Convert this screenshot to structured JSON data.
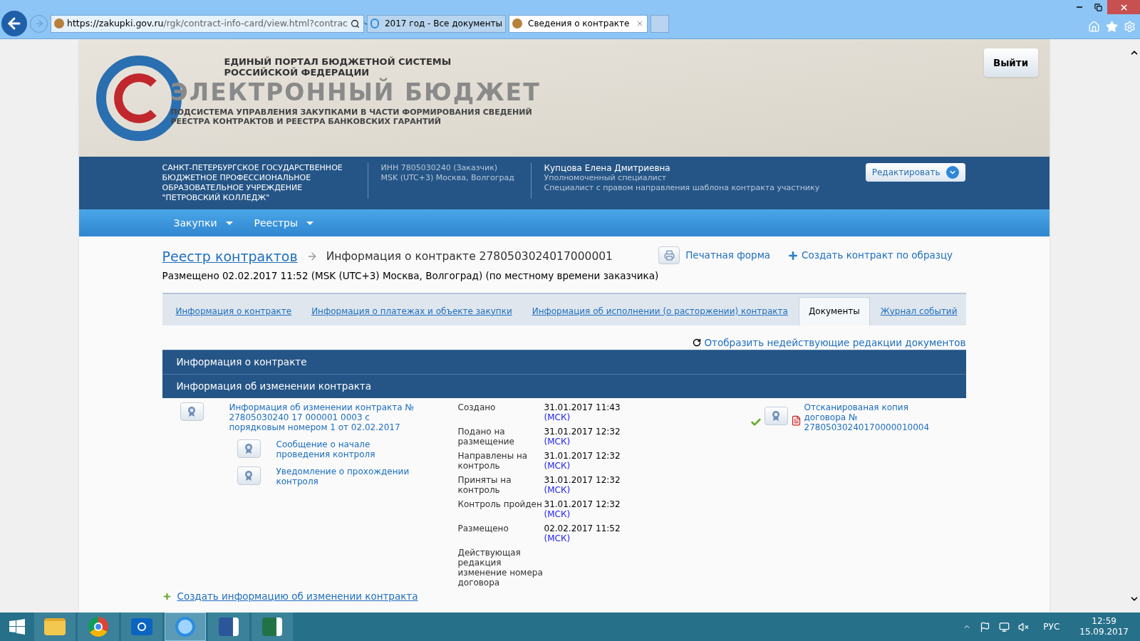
{
  "browser": {
    "address": {
      "host": "https://zakupki.gov.ru",
      "path": "/rgk/contract-info-card/view.html?contrac"
    },
    "tabs": [
      {
        "title": "2017 год - Все документы",
        "selected": false,
        "kind": "ie"
      },
      {
        "title": "Сведения о контракте",
        "selected": true,
        "kind": "emblem"
      }
    ]
  },
  "header": {
    "portal_lines": [
      "ЕДИНЫЙ ПОРТАЛ БЮДЖЕТНОЙ СИСТЕМЫ",
      "РОССИЙСКОЙ ФЕДЕРАЦИИ"
    ],
    "system_title": "ЭЛЕКТРОННЫЙ БЮДЖЕТ",
    "subsystem_lines": [
      "ПОДСИСТЕМА УПРАВЛЕНИЯ ЗАКУПКАМИ В ЧАСТИ ФОРМИРОВАНИЯ СВЕДЕНИЙ",
      "РЕЕСТРА КОНТРАКТОВ И РЕЕСТРА БАНКОВСКИХ ГАРАНТИЙ"
    ],
    "logout": "Выйти"
  },
  "user_bar": {
    "organization": "САНКТ-ПЕТЕРБУРГСКОЕ ГОСУДАРСТВЕННОЕ БЮДЖЕТНОЕ ПРОФЕССИОНАЛЬНОЕ ОБРАЗОВАТЕЛЬНОЕ УЧРЕЖДЕНИЕ \"ПЕТРОВСКИЙ КОЛЛЕДЖ\"",
    "inn": "ИНН 7805030240 (Заказчик)",
    "timezone": "MSK (UTC+3) Москва, Волгоград",
    "user_name": "Купцова Елена Дмитриевна",
    "roles": [
      "Уполномоченный специалист",
      "Специалист с правом направления шаблона контракта участнику"
    ],
    "edit_button": "Редактировать"
  },
  "nav": [
    "Закупки",
    "Реестры"
  ],
  "breadcrumb": {
    "root": "Реестр контрактов",
    "current": "Информация о контракте 2780503024017000001"
  },
  "actions": [
    "Печатная форма",
    "Создать контракт по образцу"
  ],
  "placed_note": "Размещено 02.02.2017 11:52 (MSK (UTC+3) Москва, Волгоград) (по местному времени заказчика)",
  "tabs": [
    {
      "label": "Информация о контракте",
      "selected": false
    },
    {
      "label": "Информация о платежах и объекте закупки",
      "selected": false
    },
    {
      "label": "Информация об исполнении (о расторжении) контракта",
      "selected": false
    },
    {
      "label": "Документы",
      "selected": true
    },
    {
      "label": "Журнал событий",
      "selected": false
    }
  ],
  "show_inactive_link": "Отобразить недействующие редакции документов",
  "sections": [
    "Информация о контракте",
    "Информация об изменении контракта"
  ],
  "document": {
    "title": "Информация об изменении контракта № 27805030240 17 000001 0003 с порядковым номером 1 от 02.02.2017",
    "children": [
      {
        "title": "Сообщение о начале проведения контроля"
      },
      {
        "title": "Уведомление о прохождении контроля"
      }
    ]
  },
  "timeline": [
    {
      "label": "Создано",
      "date": "31.01.2017 11:43",
      "tz": "(МСК)"
    },
    {
      "label": "Подано на размещение",
      "date": "31.01.2017 12:32",
      "tz": "(МСК)"
    },
    {
      "label": "Направлены на контроль",
      "date": "31.01.2017 12:32",
      "tz": "(МСК)"
    },
    {
      "label": "Приняты на контроль",
      "date": "31.01.2017 12:32",
      "tz": "(МСК)"
    },
    {
      "label": "Контроль пройден",
      "date": "31.01.2017 12:32",
      "tz": "(МСК)"
    },
    {
      "label": "Размещено",
      "date": "02.02.2017 11:52",
      "tz": "(МСК)"
    },
    {
      "label": "Действующая редакция изменение номера договора"
    }
  ],
  "attachment": {
    "title": "Отсканированая копия договора № 27805030240170000010004",
    "verified": true
  },
  "create_change_link": "Создать информацию об изменении контракта",
  "taskbar": {
    "apps": [
      {
        "kind": "explorer",
        "selected": false
      },
      {
        "kind": "chrome",
        "selected": false
      },
      {
        "kind": "outlook",
        "selected": false
      },
      {
        "kind": "ie",
        "selected": true
      },
      {
        "kind": "word",
        "selected": false
      },
      {
        "kind": "excel",
        "selected": false
      }
    ],
    "language": "РУС",
    "time": "12:59",
    "date": "15.09.2017"
  }
}
